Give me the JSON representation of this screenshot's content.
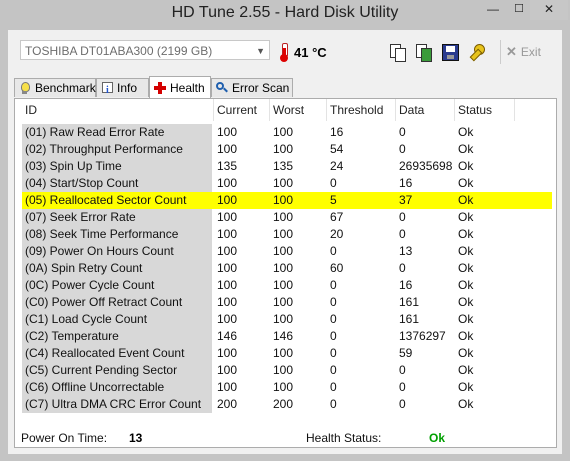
{
  "window": {
    "title": "HD Tune 2.55 - Hard Disk Utility",
    "minimize_glyph": "—",
    "maximize_glyph": "☐",
    "close_glyph": "✕"
  },
  "toolbar": {
    "drive": "TOSHIBA DT01ABA300 (2199 GB)",
    "temperature": "41 °C",
    "exit_label": "Exit",
    "icons": [
      "copy-text-icon",
      "copy-screenshot-icon",
      "save-icon",
      "options-key-icon",
      "exit-icon"
    ]
  },
  "tabs": [
    {
      "label": "Benchmark",
      "icon": "bulb-icon"
    },
    {
      "label": "Info",
      "icon": "info-icon"
    },
    {
      "label": "Health",
      "icon": "health-cross-icon",
      "active": true
    },
    {
      "label": "Error Scan",
      "icon": "magnifier-icon"
    }
  ],
  "table": {
    "columns": [
      "ID",
      "Current",
      "Worst",
      "Threshold",
      "Data",
      "Status"
    ],
    "highlight_color": "#ffff00",
    "rows": [
      [
        "(01) Raw Read Error Rate",
        "100",
        "100",
        "16",
        "0",
        "Ok"
      ],
      [
        "(02) Throughput Performance",
        "100",
        "100",
        "54",
        "0",
        "Ok"
      ],
      [
        "(03) Spin Up Time",
        "135",
        "135",
        "24",
        "26935698",
        "Ok"
      ],
      [
        "(04) Start/Stop Count",
        "100",
        "100",
        "0",
        "16",
        "Ok"
      ],
      [
        "(05) Reallocated Sector Count",
        "100",
        "100",
        "5",
        "37",
        "Ok"
      ],
      [
        "(07) Seek Error Rate",
        "100",
        "100",
        "67",
        "0",
        "Ok"
      ],
      [
        "(08) Seek Time Performance",
        "100",
        "100",
        "20",
        "0",
        "Ok"
      ],
      [
        "(09) Power On Hours Count",
        "100",
        "100",
        "0",
        "13",
        "Ok"
      ],
      [
        "(0A) Spin Retry Count",
        "100",
        "100",
        "60",
        "0",
        "Ok"
      ],
      [
        "(0C) Power Cycle Count",
        "100",
        "100",
        "0",
        "16",
        "Ok"
      ],
      [
        "(C0) Power Off Retract Count",
        "100",
        "100",
        "0",
        "161",
        "Ok"
      ],
      [
        "(C1) Load Cycle Count",
        "100",
        "100",
        "0",
        "161",
        "Ok"
      ],
      [
        "(C2) Temperature",
        "146",
        "146",
        "0",
        "1376297",
        "Ok"
      ],
      [
        "(C4) Reallocated Event Count",
        "100",
        "100",
        "0",
        "59",
        "Ok"
      ],
      [
        "(C5) Current Pending Sector",
        "100",
        "100",
        "0",
        "0",
        "Ok"
      ],
      [
        "(C6) Offline Uncorrectable",
        "100",
        "100",
        "0",
        "0",
        "Ok"
      ],
      [
        "(C7) Ultra DMA CRC Error Count",
        "200",
        "200",
        "0",
        "0",
        "Ok"
      ]
    ],
    "highlighted_row_index": 4
  },
  "footer": {
    "power_on_label": "Power On Time:",
    "power_on_value": "13",
    "health_label": "Health Status:",
    "health_value": "Ok",
    "health_color": "#00a000"
  }
}
